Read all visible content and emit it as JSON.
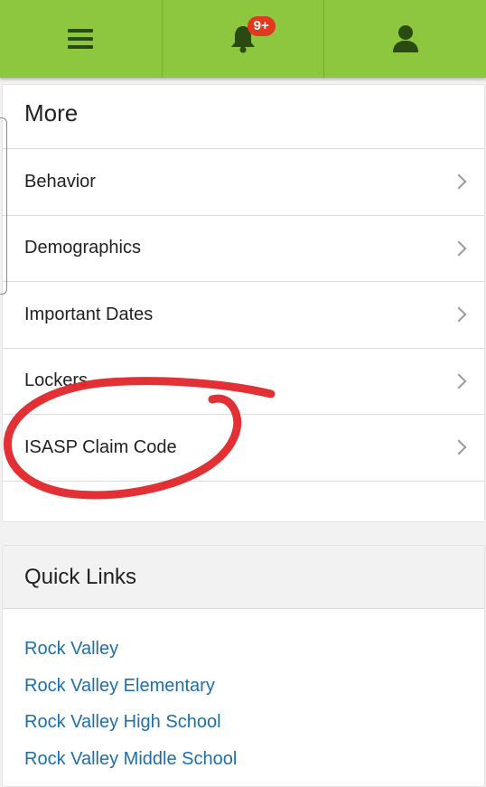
{
  "topbar": {
    "bg_color": "#8dc63f",
    "icon_color": "#2a4a12",
    "menu_icon": "hamburger-menu-icon",
    "notification_icon": "bell-icon",
    "notification_badge": "9+",
    "badge_color": "#e0391f",
    "profile_icon": "user-icon"
  },
  "more": {
    "title": "More",
    "items": [
      {
        "label": "Behavior"
      },
      {
        "label": "Demographics"
      },
      {
        "label": "Important Dates"
      },
      {
        "label": "Lockers"
      },
      {
        "label": "ISASP Claim Code"
      }
    ]
  },
  "quick_links": {
    "title": "Quick Links",
    "link_color": "#1e6fa8",
    "items": [
      {
        "label": "Rock Valley"
      },
      {
        "label": "Rock Valley Elementary"
      },
      {
        "label": "Rock Valley High School"
      },
      {
        "label": "Rock Valley Middle School"
      }
    ]
  },
  "annotation": {
    "color": "#e0252a",
    "shape": "hand-drawn-circle around ISASP Claim Code"
  }
}
